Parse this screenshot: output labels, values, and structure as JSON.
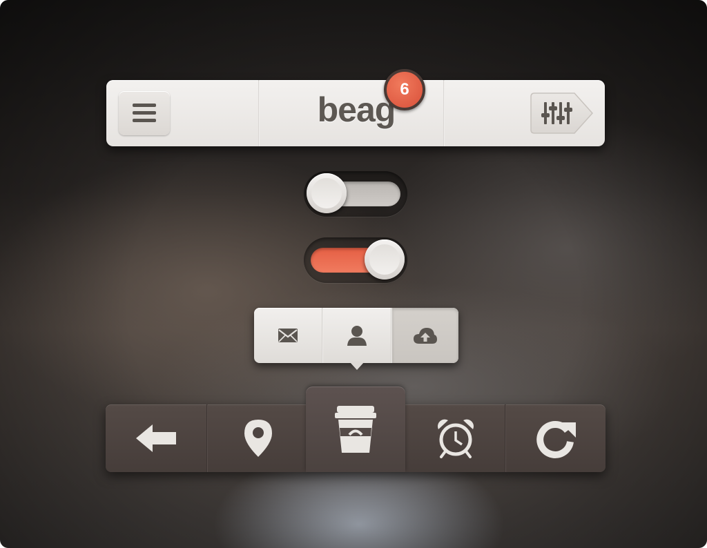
{
  "header": {
    "logo_text": "beag",
    "badge_count": "6",
    "menu_icon": "hamburger-menu-icon",
    "filter_icon": "equalizer-sliders-icon"
  },
  "toggles": [
    {
      "name": "toggle-1",
      "state": "off"
    },
    {
      "name": "toggle-2",
      "state": "on",
      "accent": "#e8694d"
    }
  ],
  "segmented": {
    "items": [
      {
        "icon": "mail-icon",
        "active": false
      },
      {
        "icon": "user-icon",
        "active": false
      },
      {
        "icon": "cloud-upload-icon",
        "active": true
      }
    ]
  },
  "tabbar": {
    "items": [
      {
        "icon": "back-arrow-icon",
        "active": false
      },
      {
        "icon": "location-pin-icon",
        "active": false
      },
      {
        "icon": "coffee-cup-icon",
        "active": true
      },
      {
        "icon": "alarm-clock-icon",
        "active": false
      },
      {
        "icon": "refresh-icon",
        "active": false
      }
    ]
  },
  "colors": {
    "accent": "#e8694d",
    "badge": "#dd573f",
    "light_panel": "#ebe8e5",
    "dark_panel": "#4d4441",
    "icon_light": "#e9e6e2",
    "icon_dark": "#5a5550"
  }
}
